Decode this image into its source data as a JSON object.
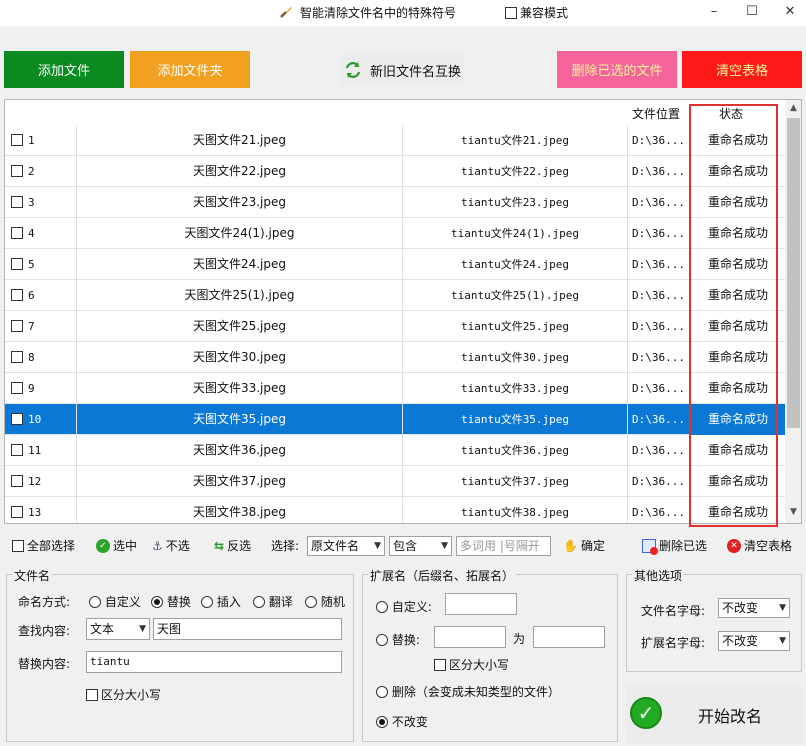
{
  "title": "智能清除文件名中的特殊符号",
  "compat_mode": "兼容模式",
  "window_buttons": {
    "minimize": "–",
    "maximize": "☐",
    "close": "✕"
  },
  "top_buttons": {
    "add_file": "添加文件",
    "add_folder": "添加文件夹",
    "swap": "新旧文件名互换",
    "delete_selected": "删除已选的文件",
    "clear_table": "清空表格"
  },
  "table": {
    "headers": {
      "location": "文件位置",
      "status": "状态"
    },
    "rows": [
      {
        "no": "1",
        "old": "天图文件21.jpeg",
        "new": "tiantu文件21.jpeg",
        "loc": "D:\\36...",
        "status": "重命名成功"
      },
      {
        "no": "2",
        "old": "天图文件22.jpeg",
        "new": "tiantu文件22.jpeg",
        "loc": "D:\\36...",
        "status": "重命名成功"
      },
      {
        "no": "3",
        "old": "天图文件23.jpeg",
        "new": "tiantu文件23.jpeg",
        "loc": "D:\\36...",
        "status": "重命名成功"
      },
      {
        "no": "4",
        "old": "天图文件24(1).jpeg",
        "new": "tiantu文件24(1).jpeg",
        "loc": "D:\\36...",
        "status": "重命名成功"
      },
      {
        "no": "5",
        "old": "天图文件24.jpeg",
        "new": "tiantu文件24.jpeg",
        "loc": "D:\\36...",
        "status": "重命名成功"
      },
      {
        "no": "6",
        "old": "天图文件25(1).jpeg",
        "new": "tiantu文件25(1).jpeg",
        "loc": "D:\\36...",
        "status": "重命名成功"
      },
      {
        "no": "7",
        "old": "天图文件25.jpeg",
        "new": "tiantu文件25.jpeg",
        "loc": "D:\\36...",
        "status": "重命名成功"
      },
      {
        "no": "8",
        "old": "天图文件30.jpeg",
        "new": "tiantu文件30.jpeg",
        "loc": "D:\\36...",
        "status": "重命名成功"
      },
      {
        "no": "9",
        "old": "天图文件33.jpeg",
        "new": "tiantu文件33.jpeg",
        "loc": "D:\\36...",
        "status": "重命名成功"
      },
      {
        "no": "10",
        "old": "天图文件35.jpeg",
        "new": "tiantu文件35.jpeg",
        "loc": "D:\\36...",
        "status": "重命名成功"
      },
      {
        "no": "11",
        "old": "天图文件36.jpeg",
        "new": "tiantu文件36.jpeg",
        "loc": "D:\\36...",
        "status": "重命名成功"
      },
      {
        "no": "12",
        "old": "天图文件37.jpeg",
        "new": "tiantu文件37.jpeg",
        "loc": "D:\\36...",
        "status": "重命名成功"
      },
      {
        "no": "13",
        "old": "天图文件38.jpeg",
        "new": "tiantu文件38.jpeg",
        "loc": "D:\\36...",
        "status": "重命名成功"
      }
    ]
  },
  "toolbar": {
    "select_all": "全部选择",
    "select": "选中",
    "deselect": "不选",
    "invert": "反选",
    "choose_label": "选择:",
    "field_select": "原文件名",
    "match_select": "包含",
    "keyword_placeholder": "多词用 |号隔开",
    "confirm": "确定",
    "delete_selected": "删除已选",
    "clear_table": "清空表格"
  },
  "filename_group": {
    "title": "文件名",
    "naming_label": "命名方式:",
    "modes": [
      "自定义",
      "替换",
      "插入",
      "翻译",
      "随机"
    ],
    "find_label": "查找内容:",
    "find_type": "文本",
    "find_value": "天图",
    "replace_label": "替换内容:",
    "replace_value": "tiantu",
    "case_sensitive": "区分大小写"
  },
  "ext_group": {
    "title": "扩展名（后缀名、拓展名）",
    "custom": "自定义:",
    "replace": "替换:",
    "to": "为",
    "case_sensitive": "区分大小写",
    "delete": "删除（会变成未知类型的文件）",
    "unchanged": "不改变"
  },
  "other_group": {
    "title": "其他选项",
    "filename_case_label": "文件名字母:",
    "filename_case_value": "不改变",
    "ext_case_label": "扩展名字母:",
    "ext_case_value": "不改变"
  },
  "start_button": "开始改名"
}
